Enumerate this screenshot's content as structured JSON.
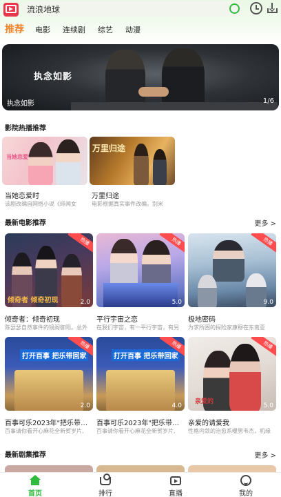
{
  "header": {
    "search_text": "流浪地球",
    "tabs": [
      {
        "label": "推荐",
        "active": true
      },
      {
        "label": "电影"
      },
      {
        "label": "连续剧"
      },
      {
        "label": "综艺"
      },
      {
        "label": "动漫"
      }
    ],
    "icons": {
      "logo": "video-logo-icon",
      "search": "search-icon",
      "history": "clock-icon",
      "download": "download-icon"
    },
    "accent_color": "#2fbb3c",
    "tab_active_color": "#f0832a"
  },
  "banner": {
    "title_art": "执念如影",
    "caption": "执念如影",
    "counter": "1/6"
  },
  "hot_section": {
    "title": "影院热播推荐",
    "items": [
      {
        "title": "当她恋爱时",
        "desc": "该剧改编自网络小说《绯闻女",
        "art_text": "当她恋爱时"
      },
      {
        "title": "万里归途",
        "desc": "电影根据真实事件改编。别米",
        "art_text": "万里归途"
      }
    ]
  },
  "movies_section": {
    "title": "最新电影推荐",
    "more": "更多 >",
    "badge": "热播",
    "items": [
      {
        "title": "倾奇者：倾奇初现",
        "desc": "陈瑟瑟自然事件的镜阁御阳。总外",
        "score": "2.0",
        "art_text": "倾奇者 倾奇初现"
      },
      {
        "title": "平行宇宙之恋",
        "desc": "在我们宇宙，有一平行宇宙，有另",
        "score": "5.0",
        "art_text": ""
      },
      {
        "title": "极地密码",
        "desc": "为求所困的探险家康穆在东南亚",
        "score": "9.0",
        "art_text": ""
      },
      {
        "title": "百事可乐2023年\"把乐带回...",
        "desc": "百事请你看开心麻花全新贺岁片,",
        "score": "2.0",
        "art_text": "打开百事 把乐带回家"
      },
      {
        "title": "百事可乐2023年\"把乐带回家\"",
        "desc": "百事请你看开心麻花全新贺岁片,",
        "score": "4.0",
        "art_text": "打开百事 把乐带回家"
      },
      {
        "title": "亲爱的请爱我",
        "desc": "性格内敛的治愈系暖男韦杰，机缘",
        "score": "5.0",
        "art_text": "亲爱的"
      }
    ]
  },
  "series_section": {
    "title": "最新剧集推荐",
    "more": "更多 >"
  },
  "bottom_nav": [
    {
      "label": "首页",
      "icon": "home-icon",
      "active": true
    },
    {
      "label": "排行",
      "icon": "ranking-icon"
    },
    {
      "label": "直播",
      "icon": "live-tv-icon"
    },
    {
      "label": "我的",
      "icon": "profile-icon"
    }
  ]
}
